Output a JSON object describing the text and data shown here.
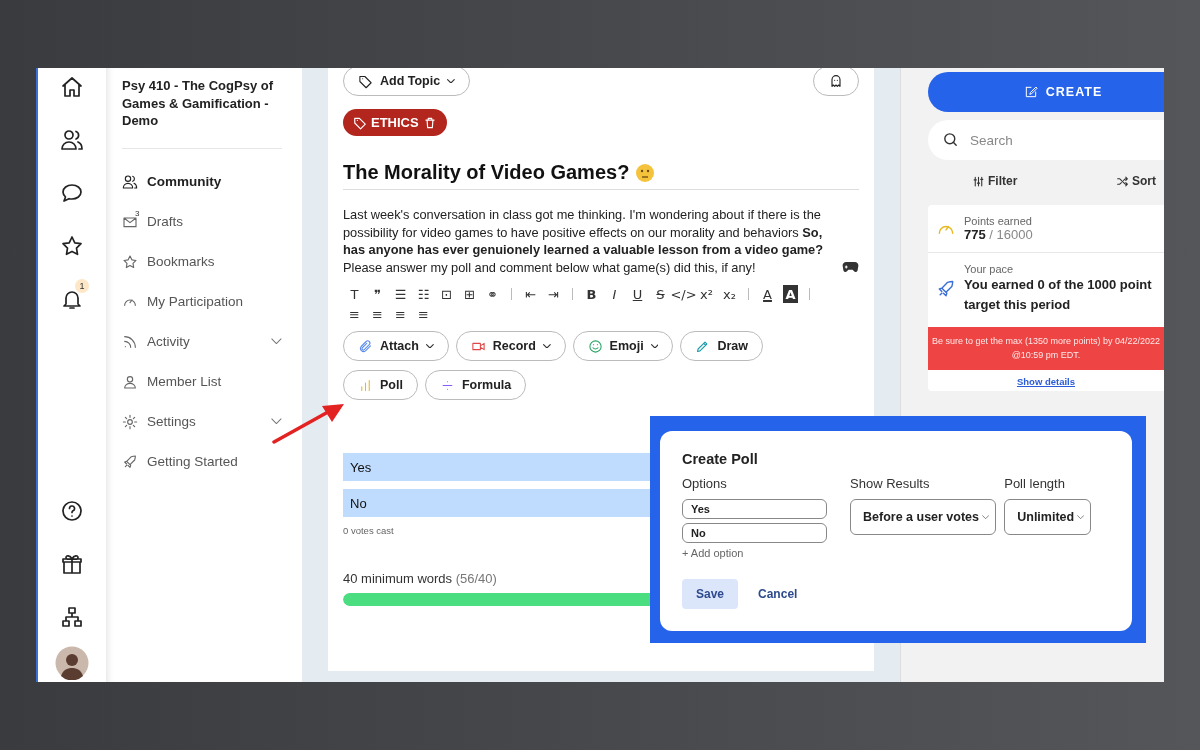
{
  "rail": {
    "notification_badge": "1"
  },
  "sidebar": {
    "course_title": "Psy 410 - The CogPsy of Games & Gamification - Demo",
    "items": [
      {
        "label": "Community",
        "selected": true,
        "kind": "link"
      },
      {
        "label": "Drafts",
        "selected": false,
        "kind": "link",
        "badge": "3"
      },
      {
        "label": "Bookmarks",
        "selected": false,
        "kind": "link"
      },
      {
        "label": "My Participation",
        "selected": false,
        "kind": "link"
      },
      {
        "label": "Activity",
        "selected": false,
        "kind": "group"
      },
      {
        "label": "Member List",
        "selected": false,
        "kind": "link"
      },
      {
        "label": "Settings",
        "selected": false,
        "kind": "group"
      },
      {
        "label": "Getting Started",
        "selected": false,
        "kind": "link"
      }
    ]
  },
  "editor": {
    "add_topic": "Add Topic",
    "tag": "ETHICS",
    "title": "The Morality of Video Games?",
    "body": "Last week's conversation in class got me thinking. I'm wondering about if there is the possibility for video games to have positive effects on our morality and behaviors **So, has anyone has ever genuionely learned a valuable lesson from a video game?** Please answer my poll and comment below what game(s) did this, if any!",
    "toolbar": [
      [
        {
          "glyph": "T",
          "kind": "plain"
        },
        {
          "glyph": "❞",
          "kind": "plain"
        },
        {
          "glyph": "☰",
          "kind": "plain"
        },
        {
          "glyph": "☷",
          "kind": "plain"
        },
        {
          "glyph": "⊡",
          "kind": "plain"
        },
        {
          "glyph": "⊞",
          "kind": "plain"
        },
        {
          "glyph": "⚭",
          "kind": "plain"
        }
      ],
      [
        {
          "glyph": "⇤",
          "kind": "plain"
        },
        {
          "glyph": "⇥",
          "kind": "plain"
        }
      ],
      [
        {
          "glyph": "B",
          "kind": "bold"
        },
        {
          "glyph": "I",
          "kind": "italic"
        },
        {
          "glyph": "U",
          "kind": "underline"
        },
        {
          "glyph": "S",
          "kind": "strike"
        },
        {
          "glyph": "</>",
          "kind": "plain"
        },
        {
          "glyph": "x²",
          "kind": "plain"
        },
        {
          "glyph": "x₂",
          "kind": "plain"
        }
      ],
      [
        {
          "glyph": "A",
          "kind": "color"
        },
        {
          "glyph": "A",
          "kind": "highlight"
        }
      ],
      [
        {
          "glyph": "≡",
          "kind": "plain"
        },
        {
          "glyph": "≡",
          "kind": "plain"
        },
        {
          "glyph": "≡",
          "kind": "plain"
        },
        {
          "glyph": "≡",
          "kind": "plain"
        }
      ]
    ],
    "actions": [
      {
        "label": "Attach",
        "dropdown": true
      },
      {
        "label": "Record",
        "dropdown": true
      },
      {
        "label": "Emoji",
        "dropdown": true
      },
      {
        "label": "Draw",
        "dropdown": false
      },
      {
        "label": "Poll",
        "dropdown": false
      },
      {
        "label": "Formula",
        "dropdown": false
      }
    ],
    "poll_results": {
      "options": [
        {
          "label": "Yes"
        },
        {
          "label": "No"
        }
      ],
      "votes": "0 votes cast"
    },
    "word_count": {
      "label": "40 minimum words",
      "count": "(56/40)",
      "level": 1
    }
  },
  "right": {
    "create": "CREATE",
    "search": {
      "placeholder": "Search"
    },
    "filter": "Filter",
    "sort": "Sort",
    "points": {
      "label": "Points earned",
      "value": "**775** / 16000"
    },
    "pace": {
      "label": "Your pace",
      "text": "You earned 0 of the 1000 point target this period"
    },
    "alert": "Be sure to get the max (1350 more points) by 04/22/2022 @10:59 pm EDT.",
    "details_link": "Show details"
  },
  "poll_dialog": {
    "title": "Create Poll",
    "options_label": "Options",
    "options": [
      {
        "value": "Yes"
      },
      {
        "value": "No"
      }
    ],
    "add_option": "+ Add option",
    "show_results": {
      "label": "Show Results",
      "value": "Before a user votes"
    },
    "poll_length": {
      "label": "Poll length",
      "value": "Unlimited"
    },
    "save": "Save",
    "cancel": "Cancel"
  }
}
